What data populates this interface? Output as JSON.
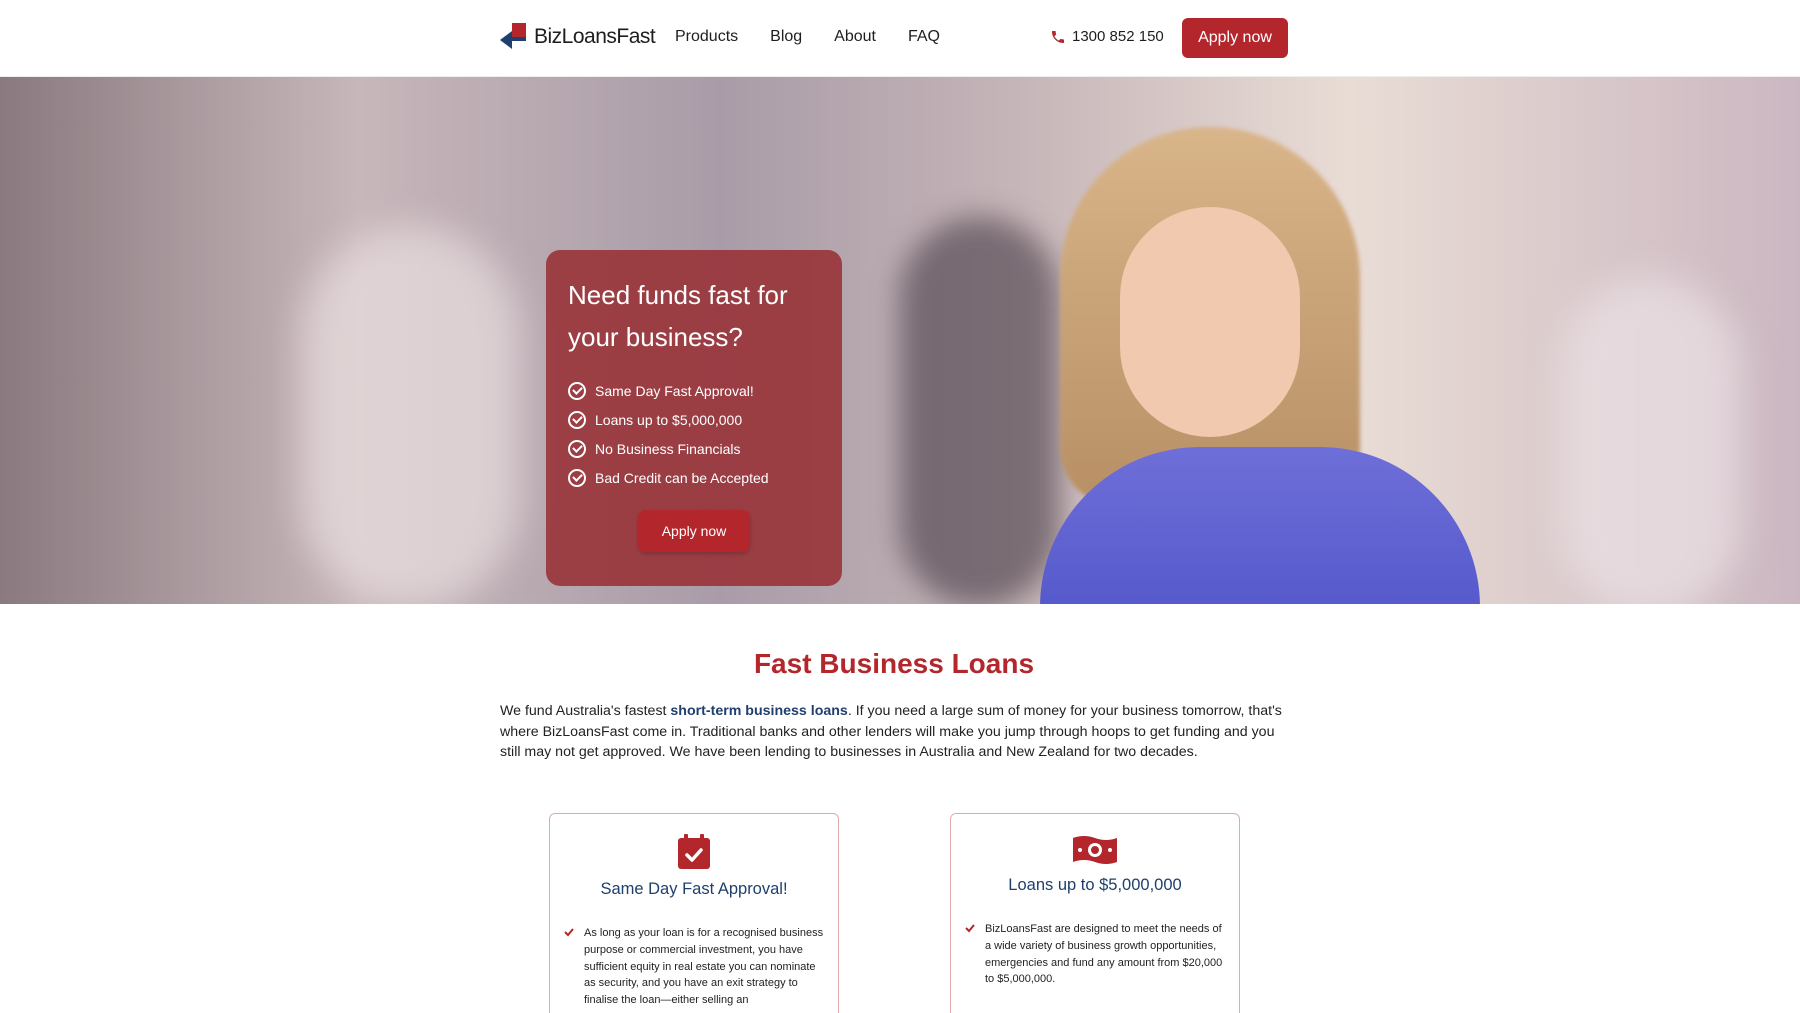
{
  "header": {
    "logo_text": "BizLoansFast",
    "nav": [
      "Products",
      "Blog",
      "About",
      "FAQ"
    ],
    "phone": "1300 852 150",
    "apply_label": "Apply now"
  },
  "hero": {
    "title": "Need funds fast for your business?",
    "features": [
      "Same Day Fast Approval!",
      "Loans up to $5,000,000",
      "No Business Financials",
      "Bad Credit can be Accepted"
    ],
    "apply_label": "Apply now"
  },
  "section": {
    "title": "Fast Business Loans",
    "intro_before": "We fund Australia's fastest ",
    "intro_link": "short-term business loans",
    "intro_after": ". If you need a large sum of money for your business tomorrow, that's where BizLoansFast come in. Traditional banks and other lenders will make you jump through hoops to get funding and you still may not get approved. We have been lending to businesses in Australia and New Zealand for two decades."
  },
  "cards": [
    {
      "icon": "calendar-check-icon",
      "title": "Same Day Fast Approval!",
      "body": "As long as your loan is for a recognised business purpose or commercial investment, you have sufficient equity in real estate you can nominate as security, and you have an exit strategy to finalise the loan—either selling an"
    },
    {
      "icon": "money-bill-icon",
      "title": "Loans up to $5,000,000",
      "body": "BizLoansFast are designed to meet the needs of a wide variety of business growth opportunities, emergencies and fund any amount from $20,000 to $5,000,000."
    }
  ],
  "colors": {
    "brand_red": "#b3262c",
    "brand_navy": "#1f3f6e"
  }
}
